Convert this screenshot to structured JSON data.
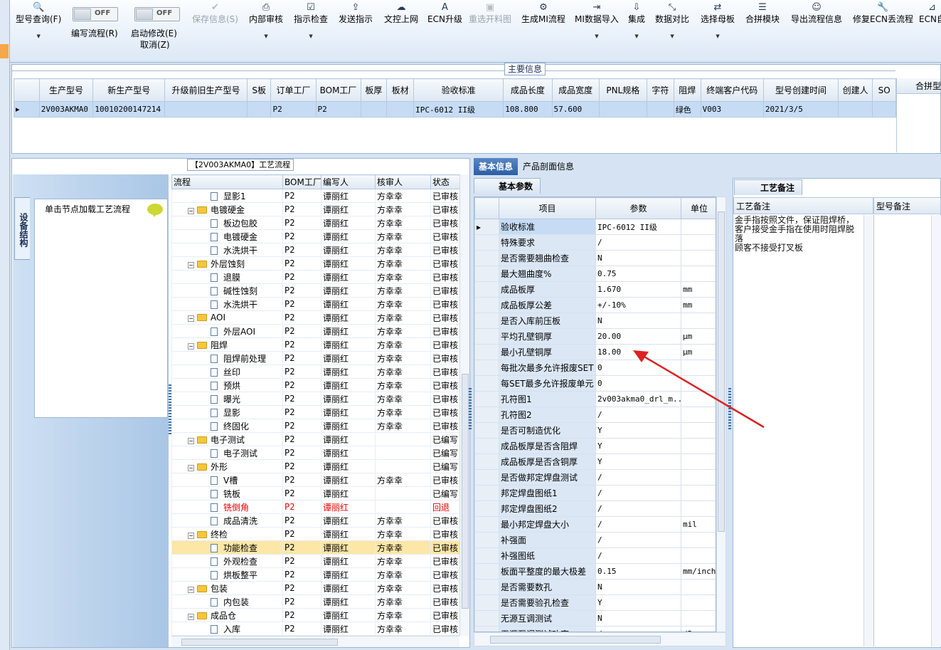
{
  "toolbar": {
    "buttons": [
      {
        "label": "型号查询(F)",
        "icon": "search-icon",
        "dropdown": true
      },
      {
        "label": "保存信息(S)",
        "icon": "check-icon",
        "disabled": true
      },
      {
        "label": "内部审核",
        "icon": "printer-icon",
        "dropdown": true
      },
      {
        "label": "指示检查",
        "icon": "checkbox-icon",
        "dropdown": true
      },
      {
        "label": "发送指示",
        "icon": "upload-icon"
      },
      {
        "label": "文控上网",
        "icon": "cloud-upload-icon"
      },
      {
        "label": "ECN升级",
        "icon": "letter-a-icon"
      },
      {
        "label": "重选开料图",
        "icon": "image-icon",
        "disabled": true
      },
      {
        "label": "生成MI流程",
        "icon": "gears-icon"
      },
      {
        "label": "MI数据导入",
        "icon": "import-icon",
        "dropdown": true
      },
      {
        "label": "集成",
        "icon": "download-icon",
        "dropdown": true
      },
      {
        "label": "数据对比",
        "icon": "compare-icon",
        "dropdown": true
      },
      {
        "label": "选择母板",
        "icon": "shuffle-icon",
        "dropdown": true
      },
      {
        "label": "合拼模块",
        "icon": "list-icon"
      },
      {
        "label": "导出流程信息",
        "icon": "smiley-icon"
      },
      {
        "label": "修复ECN丢流程",
        "icon": "wrench-icon"
      },
      {
        "label": "ECN自",
        "icon": "pin-icon"
      }
    ],
    "toggles": [
      {
        "state": "OFF",
        "label": "编写流程(R)"
      },
      {
        "state": "OFF",
        "label": "启动修改(E)",
        "sublabel": "取消(Z)"
      }
    ]
  },
  "main_info": {
    "title": "主要信息",
    "columns": [
      "生产型号",
      "新生产型号",
      "升级前旧生产型号",
      "S板",
      "订单工厂",
      "BOM工厂",
      "板厚",
      "板材",
      "验收标准",
      "成品长度",
      "成品宽度",
      "PNL规格",
      "字符",
      "阻焊",
      "终端客户代码",
      "型号创建时间",
      "创建人",
      "SO"
    ],
    "row": [
      "2V003AKMA0",
      "10010200147214",
      "",
      "",
      "P2",
      "P2",
      "",
      "",
      "IPC-6012 II级",
      "108.800",
      "57.600",
      "",
      "",
      "绿色",
      "V003",
      "2021/3/5",
      "",
      ""
    ],
    "side_header": "合拼型"
  },
  "process": {
    "title": "【2V003AKMA0】工艺流程",
    "side_tab": "设备结构",
    "hint": "单击节点加载工艺流程",
    "columns": [
      "流程",
      "BOM工厂",
      "编写人",
      "核审人",
      "状态"
    ],
    "rows": [
      {
        "name": "显影1",
        "type": "doc",
        "bom": "P2",
        "writer": "谭丽红",
        "reviewer": "方幸幸",
        "status": "已审核"
      },
      {
        "name": "电镀硬金",
        "type": "folder",
        "bom": "P2",
        "writer": "谭丽红",
        "reviewer": "方幸幸",
        "status": "已审核"
      },
      {
        "name": "板边包胶",
        "type": "doc",
        "bom": "P2",
        "writer": "谭丽红",
        "reviewer": "方幸幸",
        "status": "已审核"
      },
      {
        "name": "电镀硬金",
        "type": "doc",
        "bom": "P2",
        "writer": "谭丽红",
        "reviewer": "方幸幸",
        "status": "已审核"
      },
      {
        "name": "水洗烘干",
        "type": "doc",
        "bom": "P2",
        "writer": "谭丽红",
        "reviewer": "方幸幸",
        "status": "已审核"
      },
      {
        "name": "外层蚀刻",
        "type": "folder",
        "bom": "P2",
        "writer": "谭丽红",
        "reviewer": "方幸幸",
        "status": "已审核"
      },
      {
        "name": "退膜",
        "type": "doc",
        "bom": "P2",
        "writer": "谭丽红",
        "reviewer": "方幸幸",
        "status": "已审核"
      },
      {
        "name": "碱性蚀刻",
        "type": "doc",
        "bom": "P2",
        "writer": "谭丽红",
        "reviewer": "方幸幸",
        "status": "已审核"
      },
      {
        "name": "水洗烘干",
        "type": "doc",
        "bom": "P2",
        "writer": "谭丽红",
        "reviewer": "方幸幸",
        "status": "已审核"
      },
      {
        "name": "AOI",
        "type": "folder",
        "bom": "P2",
        "writer": "谭丽红",
        "reviewer": "方幸幸",
        "status": "已审核"
      },
      {
        "name": "外层AOI",
        "type": "doc",
        "bom": "P2",
        "writer": "谭丽红",
        "reviewer": "方幸幸",
        "status": "已审核"
      },
      {
        "name": "阻焊",
        "type": "folder",
        "bom": "P2",
        "writer": "谭丽红",
        "reviewer": "方幸幸",
        "status": "已审核"
      },
      {
        "name": "阻焊前处理",
        "type": "doc",
        "bom": "P2",
        "writer": "谭丽红",
        "reviewer": "方幸幸",
        "status": "已审核"
      },
      {
        "name": "丝印",
        "type": "doc",
        "bom": "P2",
        "writer": "谭丽红",
        "reviewer": "方幸幸",
        "status": "已审核"
      },
      {
        "name": "预烘",
        "type": "doc",
        "bom": "P2",
        "writer": "谭丽红",
        "reviewer": "方幸幸",
        "status": "已审核"
      },
      {
        "name": "曝光",
        "type": "doc",
        "bom": "P2",
        "writer": "谭丽红",
        "reviewer": "方幸幸",
        "status": "已审核"
      },
      {
        "name": "显影",
        "type": "doc",
        "bom": "P2",
        "writer": "谭丽红",
        "reviewer": "方幸幸",
        "status": "已审核"
      },
      {
        "name": "终固化",
        "type": "doc",
        "bom": "P2",
        "writer": "谭丽红",
        "reviewer": "方幸幸",
        "status": "已审核"
      },
      {
        "name": "电子测试",
        "type": "folder",
        "bom": "P2",
        "writer": "谭丽红",
        "reviewer": "",
        "status": "已编写"
      },
      {
        "name": "电子测试",
        "type": "doc",
        "bom": "P2",
        "writer": "谭丽红",
        "reviewer": "",
        "status": "已编写"
      },
      {
        "name": "外形",
        "type": "folder",
        "bom": "P2",
        "writer": "谭丽红",
        "reviewer": "",
        "status": "已编写"
      },
      {
        "name": "V槽",
        "type": "doc",
        "bom": "P2",
        "writer": "谭丽红",
        "reviewer": "方幸幸",
        "status": "已审核"
      },
      {
        "name": "铣板",
        "type": "doc",
        "bom": "P2",
        "writer": "谭丽红",
        "reviewer": "",
        "status": "已编写"
      },
      {
        "name": "铣倒角",
        "type": "doc",
        "bom": "P2",
        "writer": "谭丽红",
        "reviewer": "",
        "status": "回退",
        "red": true
      },
      {
        "name": "成品清洗",
        "type": "doc",
        "bom": "P2",
        "writer": "谭丽红",
        "reviewer": "方幸幸",
        "status": "已审核"
      },
      {
        "name": "终检",
        "type": "folder",
        "bom": "P2",
        "writer": "谭丽红",
        "reviewer": "方幸幸",
        "status": "已审核"
      },
      {
        "name": "功能检查",
        "type": "doc",
        "bom": "P2",
        "writer": "谭丽红",
        "reviewer": "方幸幸",
        "status": "已审核",
        "selected": true
      },
      {
        "name": "外观检查",
        "type": "doc",
        "bom": "P2",
        "writer": "谭丽红",
        "reviewer": "方幸幸",
        "status": "已审核"
      },
      {
        "name": "烘板整平",
        "type": "doc",
        "bom": "P2",
        "writer": "谭丽红",
        "reviewer": "方幸幸",
        "status": "已审核"
      },
      {
        "name": "包装",
        "type": "folder",
        "bom": "P2",
        "writer": "谭丽红",
        "reviewer": "方幸幸",
        "status": "已审核"
      },
      {
        "name": "内包装",
        "type": "doc",
        "bom": "P2",
        "writer": "谭丽红",
        "reviewer": "方幸幸",
        "status": "已审核"
      },
      {
        "name": "成品仓",
        "type": "folder",
        "bom": "P2",
        "writer": "谭丽红",
        "reviewer": "方幸幸",
        "status": "已审核"
      },
      {
        "name": "入库",
        "type": "doc",
        "bom": "P2",
        "writer": "谭丽红",
        "reviewer": "方幸幸",
        "status": "已审核"
      }
    ]
  },
  "details": {
    "tabs": [
      "基本信息",
      "产品剖面信息"
    ],
    "subtab": "基本参数",
    "columns": [
      "项目",
      "参数",
      "单位"
    ],
    "rows": [
      {
        "item": "验收标准",
        "param": "IPC-6012 II级",
        "unit": "",
        "current": true
      },
      {
        "item": "特殊要求",
        "param": "/",
        "unit": ""
      },
      {
        "item": "是否需要翘曲检查",
        "param": "N",
        "unit": ""
      },
      {
        "item": "最大翘曲度%",
        "param": "0.75",
        "unit": ""
      },
      {
        "item": "成品板厚",
        "param": "1.670",
        "unit": "mm"
      },
      {
        "item": "成品板厚公差",
        "param": "+/-10%",
        "unit": "mm"
      },
      {
        "item": "是否入库前压板",
        "param": "N",
        "unit": ""
      },
      {
        "item": "平均孔壁铜厚",
        "param": "20.00",
        "unit": "μm"
      },
      {
        "item": "最小孔壁铜厚",
        "param": "18.00",
        "unit": "μm"
      },
      {
        "item": "每批次最多允许报废SET",
        "param": "0",
        "unit": ""
      },
      {
        "item": "每SET最多允许报废单元",
        "param": "0",
        "unit": ""
      },
      {
        "item": "孔符图1",
        "param": "2v003akma0_drl_m...",
        "unit": ""
      },
      {
        "item": "孔符图2",
        "param": "/",
        "unit": ""
      },
      {
        "item": "是否可制造优化",
        "param": "Y",
        "unit": ""
      },
      {
        "item": "成品板厚是否含阻焊",
        "param": "Y",
        "unit": ""
      },
      {
        "item": "成品板厚是否含铜厚",
        "param": "Y",
        "unit": ""
      },
      {
        "item": "是否做邦定焊盘测试",
        "param": "/",
        "unit": ""
      },
      {
        "item": "邦定焊盘图纸1",
        "param": "/",
        "unit": ""
      },
      {
        "item": "邦定焊盘图纸2",
        "param": "/",
        "unit": ""
      },
      {
        "item": "最小邦定焊盘大小",
        "param": "/",
        "unit": "mil"
      },
      {
        "item": "补强面",
        "param": "/",
        "unit": ""
      },
      {
        "item": "补强图纸",
        "param": "/",
        "unit": ""
      },
      {
        "item": "板面平整度的最大极差",
        "param": "0.15",
        "unit": "mm/inch"
      },
      {
        "item": "是否需要数孔",
        "param": "N",
        "unit": ""
      },
      {
        "item": "是否需要验孔检查",
        "param": "Y",
        "unit": ""
      },
      {
        "item": "无源互调测试",
        "param": "N",
        "unit": ""
      },
      {
        "item": "无源互调测试功率",
        "param": "/",
        "unit": "dBm"
      }
    ]
  },
  "notes": {
    "tab": "工艺备注",
    "columns": [
      "工艺备注",
      "型号备注"
    ],
    "text": "金手指按照文件，保证阻焊桥，\n客户接受金手指在使用时阻焊脱\n落\n顾客不接受打叉板"
  },
  "colors": {
    "selection": "#c6dcf5",
    "tree_selection": "#fde7a7",
    "active_tab": "#2b5ea6",
    "annotation_arrow": "#dd2222",
    "rollback_text": "#e00000"
  }
}
